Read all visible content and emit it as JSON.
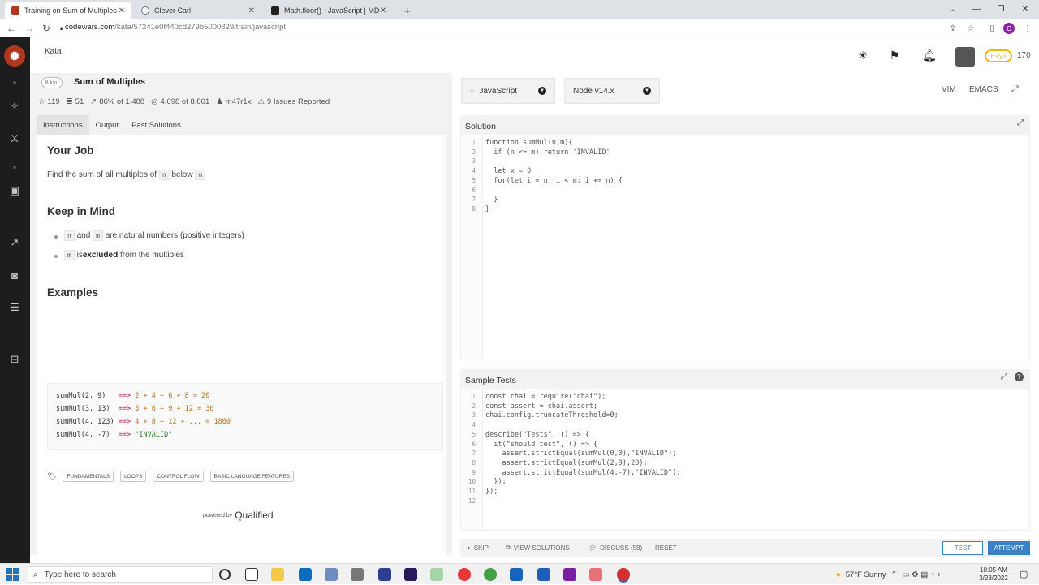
{
  "browser": {
    "tabs": [
      {
        "title": "Training on Sum of Multiples | Co",
        "active": true,
        "favicon_color": "#b1361e"
      },
      {
        "title": "Clever Carl",
        "active": false,
        "favicon_color": "#6b7280"
      },
      {
        "title": "Math.floor() - JavaScript | MDN",
        "active": false,
        "favicon_color": "#222222"
      }
    ],
    "new_tab": "+",
    "url_host": "codewars.com",
    "url_path": "/kata/57241e0f440cd279b5000829/train/javascript",
    "profile_initial": "C"
  },
  "app": {
    "breadcrumb": "Kata",
    "rank_badge": "6 kyu",
    "honor": "170"
  },
  "kata": {
    "kyu": "8 kyu",
    "title": "Sum of Multiples",
    "stats": {
      "stars": "119",
      "collections": "51",
      "satisfaction": "86% of 1,488",
      "completed": "4,698 of 8,801",
      "author": "m47r1x",
      "issues": "9 Issues Reported"
    },
    "tabs": [
      "Instructions",
      "Output",
      "Past Solutions"
    ],
    "your_job_heading": "Your Job",
    "your_job_text_pre": "Find the sum of all multiples of",
    "your_job_n": "n",
    "your_job_text_mid": "below",
    "your_job_m": "m",
    "keep_heading": "Keep in Mind",
    "bullet1_n": "n",
    "bullet1_and": "and",
    "bullet1_m": "m",
    "bullet1_rest": "are natural numbers (positive integers)",
    "bullet2_m": "m",
    "bullet2_is": "is",
    "bullet2_bold": "excluded",
    "bullet2_rest": "from the multiples",
    "examples_heading": "Examples",
    "examples": [
      {
        "call": "sumMul(2, 9)  ",
        "arrow": "==>",
        "result": "2 + 4 + 6 + 8 = 20"
      },
      {
        "call": "sumMul(3, 13) ",
        "arrow": "==>",
        "result": "3 + 6 + 9 + 12 = 30"
      },
      {
        "call": "sumMul(4, 123)",
        "arrow": "==>",
        "result": "4 + 8 + 12 + ... = 1860"
      },
      {
        "call": "sumMul(4, -7) ",
        "arrow": "==>",
        "result": "\"INVALID\""
      }
    ],
    "tags": [
      "FUNDAMENTALS",
      "LOOPS",
      "CONTROL FLOW",
      "BASIC LANGUAGE FEATURES"
    ],
    "powered_by": "powered by",
    "powered_brand": "Qualified"
  },
  "editor": {
    "language": "JavaScript",
    "runtime": "Node v14.x",
    "vim": "VIM",
    "emacs": "EMACS",
    "solution_title": "Solution",
    "solution_lines": [
      "function sumMul(n,m){",
      "  if (n <= m) return 'INVALID'",
      "",
      "  let x = 0",
      "  for(let i = n; i < m; i += n) {",
      "",
      "  }",
      "}"
    ],
    "tests_title": "Sample Tests",
    "tests_lines": [
      "const chai = require(\"chai\");",
      "const assert = chai.assert;",
      "chai.config.truncateThreshold=0;",
      "",
      "describe(\"Tests\", () => {",
      "  it(\"should test\", () => {",
      "    assert.strictEqual(sumMul(0,0),\"INVALID\");",
      "    assert.strictEqual(sumMul(2,9),20);",
      "    assert.strictEqual(sumMul(4,-7),\"INVALID\");",
      "  });",
      "});",
      ""
    ]
  },
  "actions": {
    "skip": "SKIP",
    "view_solutions": "VIEW SOLUTIONS",
    "discuss": "DISCUSS (58)",
    "reset": "RESET",
    "test": "TEST",
    "attempt": "ATTEMPT"
  },
  "taskbar": {
    "search_placeholder": "Type here to search",
    "weather": "57°F  Sunny",
    "time": "10:05 AM",
    "date": "3/23/2022"
  },
  "colors": {
    "brand_red": "#b1361e",
    "accent_blue": "#3b82c4",
    "rank_yellow": "#ecb613"
  }
}
